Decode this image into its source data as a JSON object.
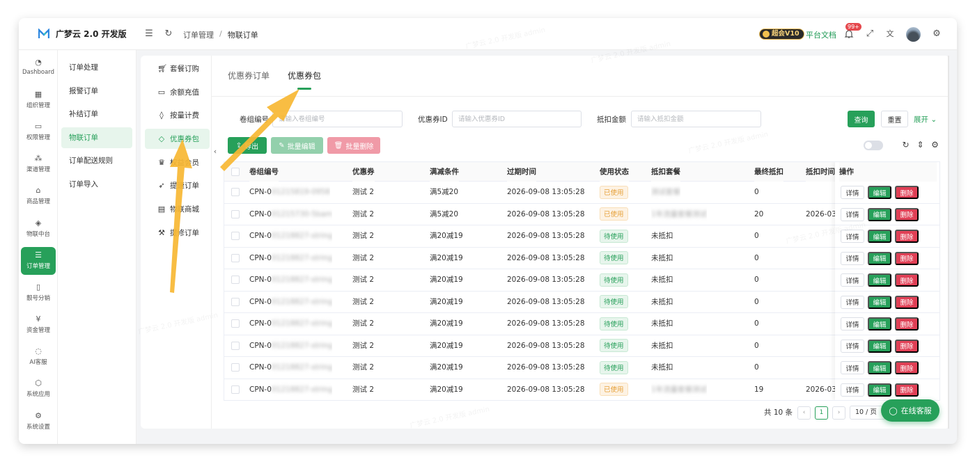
{
  "app": {
    "title": "广梦云 2.0 开发版"
  },
  "breadcrumb": [
    "订单管理",
    "物联订单"
  ],
  "header": {
    "vip": "超会V10",
    "docs": "平台文档",
    "notifications": "99+"
  },
  "side_main": [
    {
      "label": "Dashboard",
      "icon": "gauge-icon"
    },
    {
      "label": "组织管理",
      "icon": "grid-icon"
    },
    {
      "label": "权限管理",
      "icon": "laptop-icon"
    },
    {
      "label": "渠道管理",
      "icon": "network-icon"
    },
    {
      "label": "商品管理",
      "icon": "store-icon"
    },
    {
      "label": "物联中台",
      "icon": "cube-icon"
    },
    {
      "label": "订单管理",
      "icon": "list-icon",
      "active": true
    },
    {
      "label": "靓号分销",
      "icon": "phone-icon"
    },
    {
      "label": "资金管理",
      "icon": "money-icon"
    },
    {
      "label": "AI客服",
      "icon": "bot-icon"
    },
    {
      "label": "系统应用",
      "icon": "box-icon"
    },
    {
      "label": "系统设置",
      "icon": "gear-icon"
    }
  ],
  "side_sub": [
    {
      "label": "订单处理"
    },
    {
      "label": "报警订单"
    },
    {
      "label": "补结订单"
    },
    {
      "label": "物联订单",
      "active": true
    },
    {
      "label": "订单配送规则"
    },
    {
      "label": "订单导入"
    }
  ],
  "side_third": [
    {
      "label": "套餐订购",
      "icon": "cart-icon"
    },
    {
      "label": "余额充值",
      "icon": "wallet-icon"
    },
    {
      "label": "按量计费",
      "icon": "drop-icon"
    },
    {
      "label": "优惠券包",
      "icon": "ticket-icon",
      "active": true
    },
    {
      "label": "权益会员",
      "icon": "crown-icon"
    },
    {
      "label": "提速订单",
      "icon": "rocket-icon"
    },
    {
      "label": "物联商城",
      "icon": "doc-icon"
    },
    {
      "label": "提修订单",
      "icon": "hammer-icon"
    }
  ],
  "tabs": [
    {
      "label": "优惠券订单"
    },
    {
      "label": "优惠券包",
      "active": true
    }
  ],
  "filters": {
    "f1_label": "卷组编号",
    "f1_placeholder": "请输入卷组编号",
    "f2_label": "优惠券ID",
    "f2_placeholder": "请输入优惠券ID",
    "f3_label": "抵扣金额",
    "f3_placeholder": "请输入抵扣金额",
    "search": "查询",
    "reset": "重置",
    "expand": "展开"
  },
  "actions": {
    "export": "导出",
    "batch_edit": "批量编辑",
    "batch_delete": "批量删除"
  },
  "columns": [
    "卷组编号",
    "优惠券",
    "满减条件",
    "过期时间",
    "使用状态",
    "抵扣套餐",
    "最终抵扣",
    "抵扣时间",
    "操作"
  ],
  "rows": [
    {
      "id_prefix": "CPN-0",
      "id_rest": "01215819-0958",
      "coupon": "测试 2",
      "cond": "满5减20",
      "expire": "2026-09-08 13:05:28",
      "status": "已使用",
      "status_kind": "used",
      "pkg": "测试套餐",
      "pkg_blur": true,
      "final": "0",
      "time": ""
    },
    {
      "id_prefix": "CPN-0",
      "id_rest": "01215730-5bam",
      "coupon": "测试 2",
      "cond": "满5减20",
      "expire": "2026-09-08 13:05:28",
      "status": "已使用",
      "status_kind": "used",
      "pkg": "1年流量套餐测试",
      "pkg_blur": true,
      "final": "20",
      "time": "2026-03-"
    },
    {
      "id_prefix": "CPN-0",
      "id_rest": "01218827-string",
      "coupon": "测试 2",
      "cond": "满20减19",
      "expire": "2026-09-08 13:05:28",
      "status": "待使用",
      "status_kind": "wait",
      "pkg": "未抵扣",
      "pkg_blur": false,
      "final": "0",
      "time": ""
    },
    {
      "id_prefix": "CPN-0",
      "id_rest": "01218827-string",
      "coupon": "测试 2",
      "cond": "满20减19",
      "expire": "2026-09-08 13:05:28",
      "status": "待使用",
      "status_kind": "wait",
      "pkg": "未抵扣",
      "pkg_blur": false,
      "final": "0",
      "time": ""
    },
    {
      "id_prefix": "CPN-0",
      "id_rest": "01218827-string",
      "coupon": "测试 2",
      "cond": "满20减19",
      "expire": "2026-09-08 13:05:28",
      "status": "待使用",
      "status_kind": "wait",
      "pkg": "未抵扣",
      "pkg_blur": false,
      "final": "0",
      "time": ""
    },
    {
      "id_prefix": "CPN-0",
      "id_rest": "01218827-string",
      "coupon": "测试 2",
      "cond": "满20减19",
      "expire": "2026-09-08 13:05:28",
      "status": "待使用",
      "status_kind": "wait",
      "pkg": "未抵扣",
      "pkg_blur": false,
      "final": "0",
      "time": ""
    },
    {
      "id_prefix": "CPN-0",
      "id_rest": "01218827-string",
      "coupon": "测试 2",
      "cond": "满20减19",
      "expire": "2026-09-08 13:05:28",
      "status": "待使用",
      "status_kind": "wait",
      "pkg": "未抵扣",
      "pkg_blur": false,
      "final": "0",
      "time": ""
    },
    {
      "id_prefix": "CPN-0",
      "id_rest": "01218827-string",
      "coupon": "测试 2",
      "cond": "满20减19",
      "expire": "2026-09-08 13:05:28",
      "status": "待使用",
      "status_kind": "wait",
      "pkg": "未抵扣",
      "pkg_blur": false,
      "final": "0",
      "time": ""
    },
    {
      "id_prefix": "CPN-0",
      "id_rest": "01218827-string",
      "coupon": "测试 2",
      "cond": "满20减19",
      "expire": "2026-09-08 13:05:28",
      "status": "待使用",
      "status_kind": "wait",
      "pkg": "未抵扣",
      "pkg_blur": false,
      "final": "0",
      "time": ""
    },
    {
      "id_prefix": "CPN-0",
      "id_rest": "01218827-string",
      "coupon": "测试 2",
      "cond": "满20减19",
      "expire": "2026-09-08 13:05:28",
      "status": "已使用",
      "status_kind": "used",
      "pkg": "1年流量套餐测试",
      "pkg_blur": true,
      "final": "19",
      "time": "2026-03-"
    }
  ],
  "row_ops": {
    "detail": "详情",
    "edit": "编辑",
    "delete": "删除"
  },
  "pager": {
    "total": "共 10 条",
    "current": "1",
    "size": "10 / 页"
  },
  "chat": {
    "label": "在线客服"
  },
  "watermark": "广梦云 2.0 开发版 admin",
  "colors": {
    "brand": "#27a05a",
    "danger": "#e03f55",
    "warning": "#e6a23c",
    "arrow": "#f7b733"
  }
}
